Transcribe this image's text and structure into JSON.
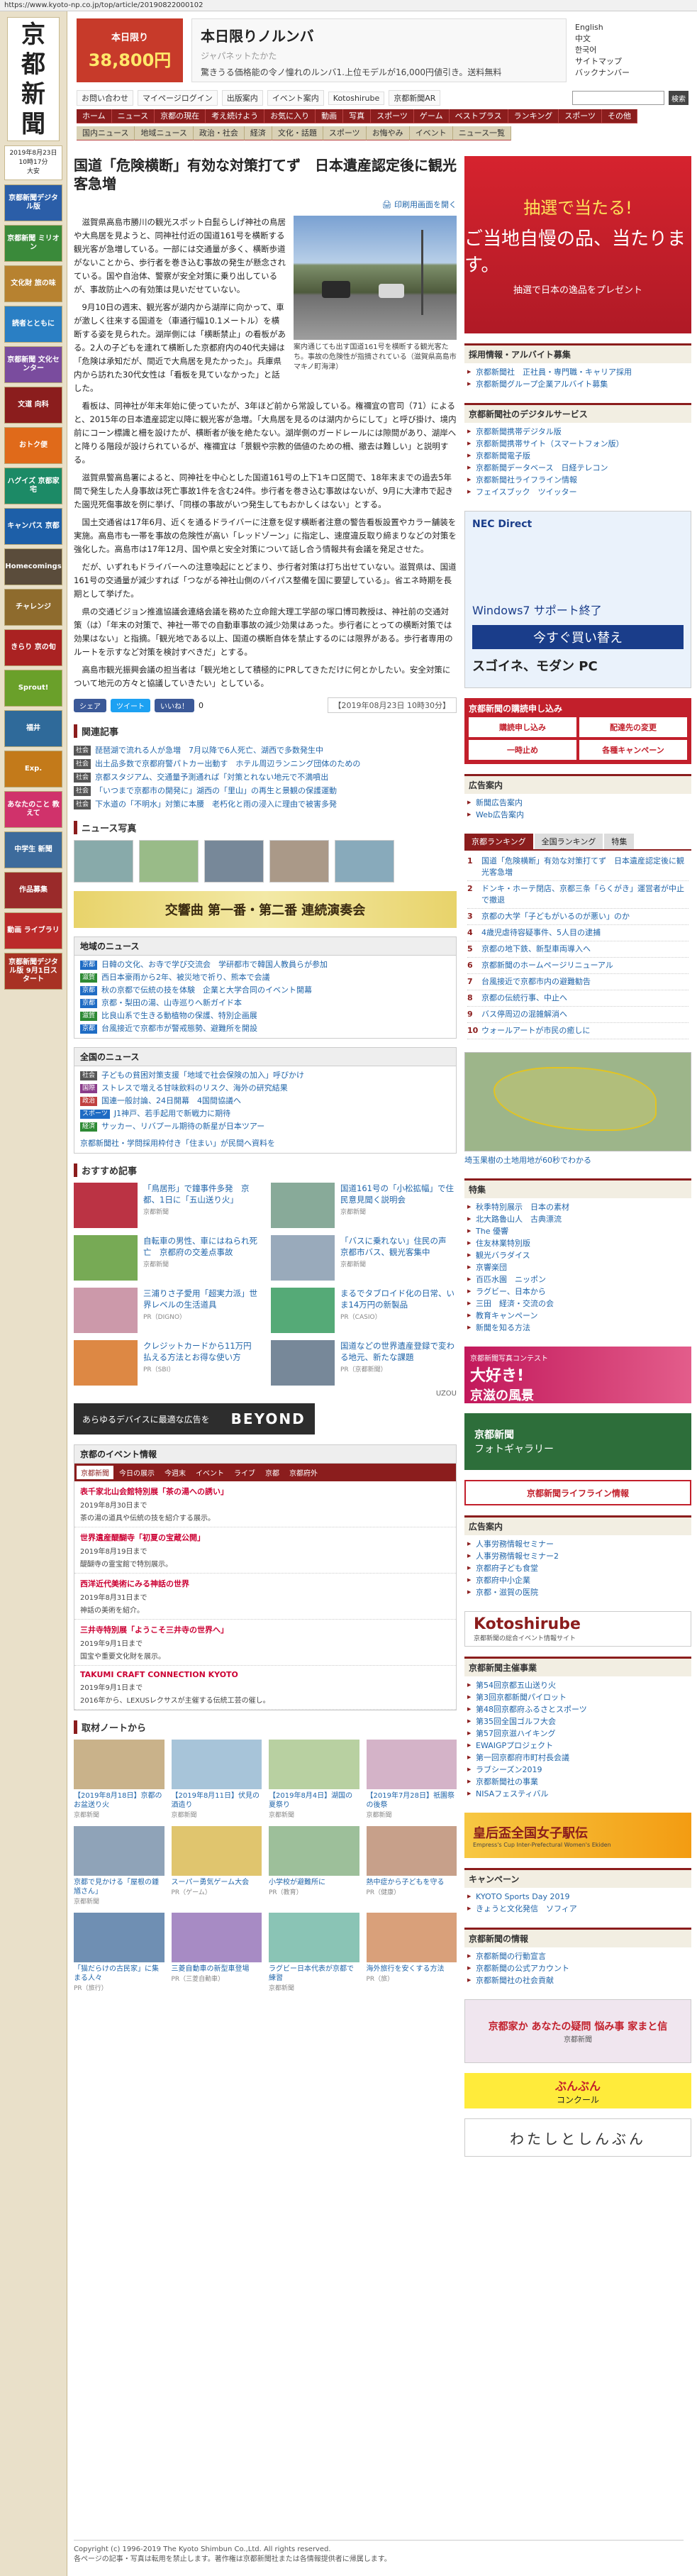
{
  "url": "https://www.kyoto-np.co.jp/top/article/20190822000102",
  "left": {
    "logo_chars": [
      "京",
      "都",
      "新",
      "聞"
    ],
    "date": "2019年8月23日",
    "time": "10時17分",
    "weekday": "大安",
    "banners": [
      {
        "label": "京都新聞デジタル版",
        "color": "#2b5ea8"
      },
      {
        "label": "京都新聞 ミリオン",
        "color": "#3a8a3a"
      },
      {
        "label": "文化財 旅の味",
        "color": "#b78230"
      },
      {
        "label": "読者とともに",
        "color": "#2a7fc4"
      },
      {
        "label": "京都新聞 文化センター",
        "color": "#7a4c9e"
      },
      {
        "label": "文道 向科",
        "color": "#8b1d1d"
      },
      {
        "label": "おトク便",
        "color": "#e06a1a"
      },
      {
        "label": "ハグイズ 京都家宅",
        "color": "#1c8a66"
      },
      {
        "label": "キャンパス 京都",
        "color": "#1d5fa8"
      },
      {
        "label": "Homecomings",
        "color": "#5a4c3b"
      },
      {
        "label": "チャレンジ",
        "color": "#8e6b2d"
      },
      {
        "label": "きらり 京の旬",
        "color": "#a22"
      },
      {
        "label": "Sprout!",
        "color": "#6aa02a"
      },
      {
        "label": "福井",
        "color": "#2f6a9a"
      },
      {
        "label": "Exp.",
        "color": "#c37a1a"
      },
      {
        "label": "あなたのこと 教えて",
        "color": "#d0326b"
      },
      {
        "label": "中学生 新聞",
        "color": "#3d6b9c"
      },
      {
        "label": "作品募集",
        "color": "#9a2a2a"
      },
      {
        "label": "動画 ライブラリ",
        "color": "#bb2a2a"
      },
      {
        "label": "京都新聞デジタル版 9月1日スタート",
        "color": "#a83224"
      }
    ]
  },
  "header": {
    "ad_badge": "本日限り",
    "ad_price": "38,800円",
    "ad_title": "本日限りノルンバ",
    "ad_sub": "ジャパネットたかた",
    "ad_desc": "驚きうる価格能の令ノ憧れのルンバ1.上位モデルが16,000円値引き。送料無料",
    "lang_items": [
      "English",
      "中文",
      "한국어",
      "サイトマップ",
      "バックナンバー"
    ],
    "toolbar": [
      "お問い合わせ",
      "マイページログイン",
      "出版案内",
      "イベント案内",
      "Kotoshirube",
      "京都新聞AR"
    ],
    "search_placeholder": "",
    "search_btn": "検索",
    "nav_main": [
      "ホーム",
      "ニュース",
      "京都の現在",
      "考え続けよう",
      "お気に入り",
      "動画",
      "写真",
      "スポーツ",
      "ゲーム",
      "ベストプラス",
      "ランキング",
      "スポーツ",
      "その他"
    ],
    "nav_sub": [
      "国内ニュース",
      "地域ニュース",
      "政治・社会",
      "経済",
      "文化・話題",
      "スポーツ",
      "お悔やみ",
      "イベント",
      "ニュース一覧"
    ]
  },
  "article": {
    "title": "国道「危険横断」有効な対策打てず　日本遺産認定後に観光客急増",
    "print_link": "印刷用画面を開く",
    "photo_caption": "案内通じても出す国道161号を横断する観光客たち。事故の危険性が指摘されている（滋賀県高島市マキノ町海津）",
    "paragraphs": [
      "滋賀県高島市勝川の観光スポット白髭らしげ神社の鳥居や大鳥居を見ようと、同神社付近の国道161号を横断する観光客が急増している。一部には交通量が多く、横断歩道がないことから、歩行者を巻き込む事故の発生が懸念されている。国や自治体、警察が安全対策に乗り出しているが、事故防止への有効策は見いだせていない。",
      "9月10日の週末、観光客が湖内から湖岸に向かって、車が激しく往来する国道を（車通行幅10.1メートル）を横断する姿を見られた。湖岸側には「横断禁止」の看板がある。2人の子どもを連れて横断した京都府内の40代夫婦は「危険は承知だが、間近で大鳥居を見たかった」。兵庫県内から訪れた30代女性は「看板を見ていなかった」と話した。",
      "看板は、同神社が年末年始に使っていたが、3年ほど前から常設している。権禰宜の官司（71）によると、2015年の日本遺産認定以降に観光客が急増。「大鳥居を見るのは湖内からにして」と呼び掛け、境内前にコーン標識と柵を設けたが、横断者が後を絶たない。湖岸側のガードレールには隙間があり、湖岸へと降りる階段が設けられているが、権禰宜は「景観や宗教的価値のための柵、撤去は難しい」と説明する。",
      "滋賀県警高島署によると、同神社を中心とした国道161号の上下1キロ区間で、18年末までの過去5年間で発生した人身事故は死亡事故1件を含む24件。歩行者を巻き込む事故はないが、9月に大津市で起きた園児死傷事故を例に挙げ、「同様の事故がいつ発生してもおかしくはない」とする。",
      "国土交通省は17年6月、近くを通るドライバーに注意を促す横断者注意の警告看板設置やカラー舗装を実施。高島市も一帯を事故の危険性が高い「レッドゾーン」に指定し、速度違反取り締まりなどの対策を強化した。高島市は17年12月、国や県と安全対策について話し合う情報共有会議を発足させた。",
      "だが、いずれもドライバーへの注意喚起にとどまり、歩行者対策は打ち出せていない。滋賀県は、国道161号の交通量が減少すれば「つながる神社山側のバイパス整備を国に要望している」。省エネ時期を長期として挙げた。",
      "県の交通ビジョン推進協議会連絡会議を務めた立命館大理工学部の塚口博司教授は、神社前の交通対策（は）「年末の対策で、神社一帯での自動車事故の減少効果はあった。歩行者にとっての横断対策では効果はない」と指摘。「観光地である以上、国道の横断自体を禁止するのには限界がある。歩行者専用のルートを示すなど対策を検討すべきだ」とする。",
      "高島市観光振興会議の担当者は「観光地として積極的にPRしてきただけに何とかしたい。安全対策について地元の方々と協議していきたい」としている。"
    ],
    "share": {
      "fb": "シェア",
      "tw": "ツイート",
      "line": "いいね！",
      "count": "0",
      "date": "【2019年08月23日 10時30分】"
    }
  },
  "related": {
    "title": "関連記事",
    "items": [
      {
        "tag": "社会",
        "text": "琵琶湖で流れる人が急増　7月以降で6人死亡、湖西で多数発生中"
      },
      {
        "tag": "社会",
        "text": "出土品多数で京都府警パトカー出動す　ホテル周辺ランニング団体のための"
      },
      {
        "tag": "社会",
        "text": "京都スタジアム、交通量予測通れば「対策とれない地元で不満噴出"
      },
      {
        "tag": "社会",
        "text": "「いつまで京都市の開発に」湖西の「里山」の再生と景観の保護運動"
      },
      {
        "tag": "社会",
        "text": "下水道の「不明水」対策に本腰　老朽化と雨の浸入に理由で被害多発"
      }
    ],
    "news_photo_title": "ニュース写真"
  },
  "concert": {
    "text": "交響曲 第一番・第二番 連続演奏会"
  },
  "local_news": {
    "title": "地域のニュース",
    "items": [
      {
        "tag": "京都",
        "color": "#1f6cc4",
        "text": "日韓の文化、お寺で学び交流会　学研都市で韓国人教員らが参加"
      },
      {
        "tag": "滋賀",
        "color": "#2d8a34",
        "text": "西日本豪雨から2年、被災地で祈り、熊本で会議"
      },
      {
        "tag": "京都",
        "color": "#1f6cc4",
        "text": "秋の京都で伝統の技を体験　企業と大学合同のイベント開幕"
      },
      {
        "tag": "京都",
        "color": "#1f6cc4",
        "text": "京都・梨田の湯、山寺巡りへ新ガイド本"
      },
      {
        "tag": "滋賀",
        "color": "#2d8a34",
        "text": "比良山系で生きる動植物の保護、特別企画展"
      },
      {
        "tag": "京都",
        "color": "#1f6cc4",
        "text": "台風接近で京都市が警戒態勢、避難所を開設"
      }
    ]
  },
  "all_news": {
    "title": "全国のニュース",
    "items": [
      {
        "tag": "社会",
        "color": "#555",
        "text": "子どもの貧困対策支援「地域で社会保険の加入」呼びかけ"
      },
      {
        "tag": "国際",
        "color": "#8a3c8a",
        "text": "ストレスで増える甘味飲料のリスク、海外の研究結果"
      },
      {
        "tag": "政治",
        "color": "#c04040",
        "text": "国連一般討論、24日開幕　4国間協議へ"
      },
      {
        "tag": "スポーツ",
        "color": "#1f6cc4",
        "text": "J1神戸、若手起用で新戦力に期待"
      },
      {
        "tag": "経済",
        "color": "#2d8a34",
        "text": "サッカー、リバプール期待の新星が日本ツアー"
      }
    ],
    "footer_link": "京都新聞社・学問採用枠付き「住まい」が民間へ資料を"
  },
  "recommend": {
    "title": "おすすめ記事",
    "items": [
      {
        "text": "「鳥居形」で鐘事件多発　京都、1日に「五山送り火」",
        "src": "京都新聞"
      },
      {
        "text": "国道161号の「小松拡幅」で住民意見聞く説明会",
        "src": "京都新聞"
      },
      {
        "text": "自転車の男性、車にはねられ死亡　京都府の交差点事故",
        "src": "京都新聞"
      },
      {
        "text": "「バスに乗れない」住民の声　京都市バス、観光客集中",
        "src": "京都新聞"
      },
      {
        "text": "三浦りさ子愛用「超実力派」世界レベルの生活道具",
        "src": "PR（DIGNO）"
      },
      {
        "text": "まるでタブロイド化の日常、いま14万円の新製品",
        "src": "PR（CASIO）"
      },
      {
        "text": "クレジットカードから11万円払える方法とお得な使い方",
        "src": "PR（SBI）"
      },
      {
        "text": "国道などの世界遺産登録で変わる地元、新たな課題",
        "src": "PR（京都新聞）"
      }
    ],
    "provider": "UZOU"
  },
  "beyond": {
    "text": "あらゆるデバイスに最適な広告を",
    "brand": "BEYOND"
  },
  "events": {
    "title": "京都のイベント情報",
    "tabs": [
      "京都新聞",
      "今日の展示",
      "今週末",
      "イベント",
      "ライブ",
      "京都",
      "京都府外"
    ],
    "items": [
      {
        "title": "表千家北山会館特別展「茶の湯への誘い」",
        "date": "2019年8月30日まで",
        "desc": "茶の湯の道具や伝統の技を紹介する展示。"
      },
      {
        "title": "世界遺産醍醐寺「初夏の宝蔵公開」",
        "date": "2019年8月19日まで",
        "desc": "醍醐寺の霊宝館で特別展示。"
      },
      {
        "title": "西洋近代美術にみる神話の世界",
        "date": "2019年8月31日まで",
        "desc": "神話の美術を紹介。"
      },
      {
        "title": "三井寺特別展「ようこそ三井寺の世界へ」",
        "date": "2019年9月1日まで",
        "desc": "国宝や重要文化財を展示。"
      },
      {
        "title": "TAKUMI CRAFT CONNECTION KYOTO",
        "date": "2019年9月1日まで",
        "desc": "2016年から、LEXUSレクサスが主催する伝統工芸の催し。"
      }
    ]
  },
  "cultures": {
    "title": "取材ノートから",
    "items": [
      {
        "text": "【2019年8月18日】京都のお盆送り火",
        "src": "京都新聞"
      },
      {
        "text": "【2019年8月11日】伏見の酒造り",
        "src": "京都新聞"
      },
      {
        "text": "【2019年8月4日】湖国の夏祭り",
        "src": "京都新聞"
      },
      {
        "text": "【2019年7月28日】祇園祭の後祭",
        "src": "京都新聞"
      },
      {
        "text": "京都で見かける「屋根の鍾馗さん」",
        "src": "京都新聞"
      },
      {
        "text": "スーパー勇気ゲーム大会",
        "src": "PR（ゲーム）"
      },
      {
        "text": "小学校が避難所に",
        "src": "PR（教育）"
      },
      {
        "text": "熱中症から子どもを守る",
        "src": "PR（健康）"
      },
      {
        "text": "「猫だらけの古民家」に集まる人々",
        "src": "PR（旅行）"
      },
      {
        "text": "三菱自動車の新型車登場",
        "src": "PR（三菱自動車）"
      },
      {
        "text": "ラグビー日本代表が京都で練習",
        "src": "京都新聞"
      },
      {
        "text": "海外旅行を安くする方法",
        "src": "PR（旅）"
      }
    ]
  },
  "footer": {
    "copy": "Copyright (c) 1996-2019 The Kyoto Shimbun Co.,Ltd. All rights reserved.",
    "note": "各ページの記事・写真は転用を禁止します。著作権は京都新聞社または各情報提供者に帰属します。"
  },
  "right": {
    "ad_top": {
      "line1": "抽選で当たる!",
      "line2": "ご当地自慢の品、当たります。",
      "line3": "抽選で日本の逸品をプレゼント"
    },
    "recruit": {
      "title": "採用情報・アルバイト募集",
      "items": [
        "京都新聞社　正社員・専門職・キャリア採用",
        "京都新聞グループ企業アルバイト募集"
      ]
    },
    "digital": {
      "title": "京都新聞社のデジタルサービス",
      "items": [
        "京都新聞携帯デジタル版",
        "京都新聞携帯サイト（スマートフォン版）",
        "京都新聞電子版",
        "京都新聞データベース　日経テレコン",
        "京都新聞社ライフライン情報",
        "フェイスブック　ツイッター"
      ]
    },
    "ad2": {
      "line1": "NEC Direct",
      "line2": "Windows7 サポート終了",
      "line3": "今すぐ買い替え",
      "line4": "スゴイネ、モダン PC"
    },
    "subscribe": {
      "title": "京都新聞の購読申し込み",
      "items": [
        "購読申し込み",
        "配達先の変更",
        "一時止め",
        "各種キャンペーン"
      ]
    },
    "ads_info": {
      "title": "広告案内",
      "items": [
        "新聞広告案内",
        "Web広告案内"
      ]
    },
    "ranking": {
      "tabs": [
        "京都ランキング",
        "全国ランキング",
        "特集"
      ],
      "items": [
        "国道「危険横断」有効な対策打てず　日本遺産認定後に観光客急増",
        "ドンキ・ホーテ閉店、京都三条「らくがき」運営者が中止で撤退",
        "京都の大学「子どもがいるのが悪い」のか",
        "4歳児虐待容疑事件、5人目の逮捕",
        "京都の地下鉄、新型車両導入へ",
        "京都新聞のホームページリニューアル",
        "台風接近で京都市内の避難勧告",
        "京都の伝統行事、中止へ",
        "バス停周辺の混雑解消へ",
        "ウォールアートが市民の癒しに"
      ]
    },
    "map": {
      "title": "埼玉果樹の土地用地が60秒でわかる"
    },
    "special": {
      "title": "特集",
      "items": [
        "秋季特別展示　日本の素材",
        "北大路魯山人　古典漂流",
        "The 優響",
        "住友林業特別版",
        "観光バラダイス",
        "京響楽団",
        "百匹水園　ニッポン",
        "ラグビー、日本から",
        "三田　経済・交流の会",
        "教育キャンペーン",
        "新聞を知る方法"
      ]
    },
    "contest": {
      "title": "京都新聞写真コンテスト",
      "line1": "大好き!",
      "line2": "京滋の風景"
    },
    "photo_club": {
      "line1": "京都新聞",
      "line2": "フォトギャラリー"
    },
    "lifeline": {
      "label": "京都新聞ライフライン情報"
    },
    "ad_info": {
      "title": "広告案内",
      "items": [
        "人事労務情報セミナー",
        "人事労務情報セミナー2",
        "京都府子ども食堂",
        "京都府中小企業",
        "京都・滋賀の医院"
      ]
    },
    "kotoshirube": {
      "label": "Kotoshirube",
      "sub": "京都新聞の総合イベント情報サイト"
    },
    "company": {
      "title": "京都新聞主催事業",
      "items": [
        "第54回京都五山送り火",
        "第3回京都新聞パイロット",
        "第48回京都府ふるさとスポーツ",
        "第35回全国ゴルフ大会",
        "第57回京滋ハイキング",
        "EWAIGPプロジェクト",
        "第一回京都府市町村長会議",
        "ラブシーズン2019",
        "京都新聞社の事業",
        "NISAフェスティバル"
      ]
    },
    "ekiden": {
      "line1": "皇后盃全国女子駅伝",
      "line2": "Empress's Cup Inter-Prefectural Women's Ekiden"
    },
    "campaign": {
      "title": "キャンペーン",
      "items": [
        "KYOTO Sports Day 2019",
        "きょうと文化発信　ソフィア"
      ]
    },
    "info": {
      "title": "京都新聞の情報",
      "items": [
        "京都新聞の行動宣言",
        "京都新聞の公式アカウント",
        "京都新聞社の社会貢献"
      ]
    },
    "ad_bottom": {
      "line1": "京都家か あなたの疑問 悩み事 家まと信",
      "sub": "京都新聞"
    },
    "kami": {
      "line1": "ぶんぶん",
      "line2": "コンクール"
    },
    "watashi": {
      "label": "わたしとしんぶん"
    }
  }
}
